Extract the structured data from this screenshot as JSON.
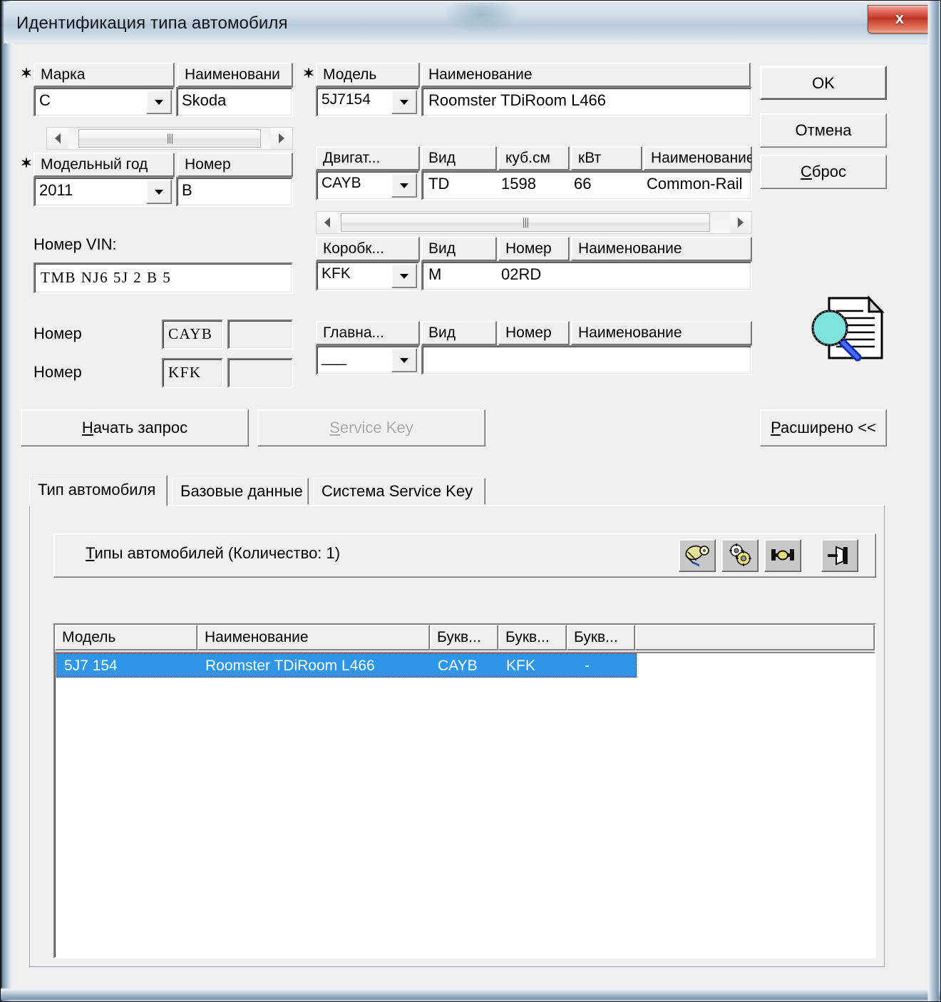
{
  "window": {
    "title": "Идентификация типа автомобиля",
    "close_label": "x"
  },
  "brand": {
    "col1_header": "Марка",
    "col2_header": "Наименовани",
    "code_value": "C",
    "name_value": "Skoda",
    "scrollbar": "horizontal-scrollbar"
  },
  "model_year": {
    "col1_header": "Модельный год",
    "col2_header": "Номер",
    "year_value": "2011",
    "number_value": "B"
  },
  "vin": {
    "label": "Номер VIN:",
    "value": "TMB  NJ6  5J  2  B  5"
  },
  "numbers": [
    {
      "label": "Номер",
      "code": "CAYB",
      "extra": ""
    },
    {
      "label": "Номер",
      "code": "KFK",
      "extra": ""
    }
  ],
  "model": {
    "col1_header": "Модель",
    "col2_header": "Наименование",
    "code_value": "5J7154",
    "name_value": "Roomster TDiRoom L466"
  },
  "engine": {
    "headers": [
      "Двигат...",
      "Вид",
      "куб.см",
      "кВт",
      "Наименование"
    ],
    "values": [
      "CAYB",
      "TD",
      "1598",
      "66",
      "Common-Rail"
    ]
  },
  "gearbox": {
    "headers": [
      "Коробк...",
      "Вид",
      "Номер",
      "Наименование"
    ],
    "values": [
      "KFK",
      "M",
      "02RD",
      ""
    ]
  },
  "final_drive": {
    "headers": [
      "Главна...",
      "Вид",
      "Номер",
      "Наименование"
    ],
    "values": [
      "___",
      "",
      "",
      ""
    ]
  },
  "side_buttons": {
    "ok": "OK",
    "cancel": "Отмена",
    "reset_prefix": "С",
    "reset_rest": "брос"
  },
  "doc_icon": "document-search-icon",
  "action_buttons": {
    "start_query_prefix": "Н",
    "start_query_rest": "ачать запрос",
    "service_key_prefix": "S",
    "service_key_rest": "ervice Key",
    "expand_prefix": "Р",
    "expand_rest": "асширено <<"
  },
  "tabs": [
    {
      "label": "Тип автомобиля",
      "active": true
    },
    {
      "label": "Базовые данные",
      "active": false
    },
    {
      "label": "Система Service Key",
      "active": false
    }
  ],
  "group": {
    "title_prefix": "Т",
    "title_rest": "ипы автомобилей (Количество: 1)",
    "toolbar": [
      "paint-brush-icon",
      "gears-icon",
      "axle-icon",
      "pin-icon"
    ]
  },
  "table": {
    "headers": [
      "Модель",
      "Наименование",
      "Букв...",
      "Букв...",
      "Букв...",
      ""
    ],
    "rows": [
      {
        "model": "5J7 154",
        "name": "Roomster TDiRoom L466",
        "letter1": "CAYB",
        "letter2": "KFK",
        "letter3": "-",
        "selected": true
      }
    ]
  },
  "colors": {
    "selection": "#2f95e8",
    "face": "#f0f0f0",
    "close_button": "#bd3224"
  }
}
